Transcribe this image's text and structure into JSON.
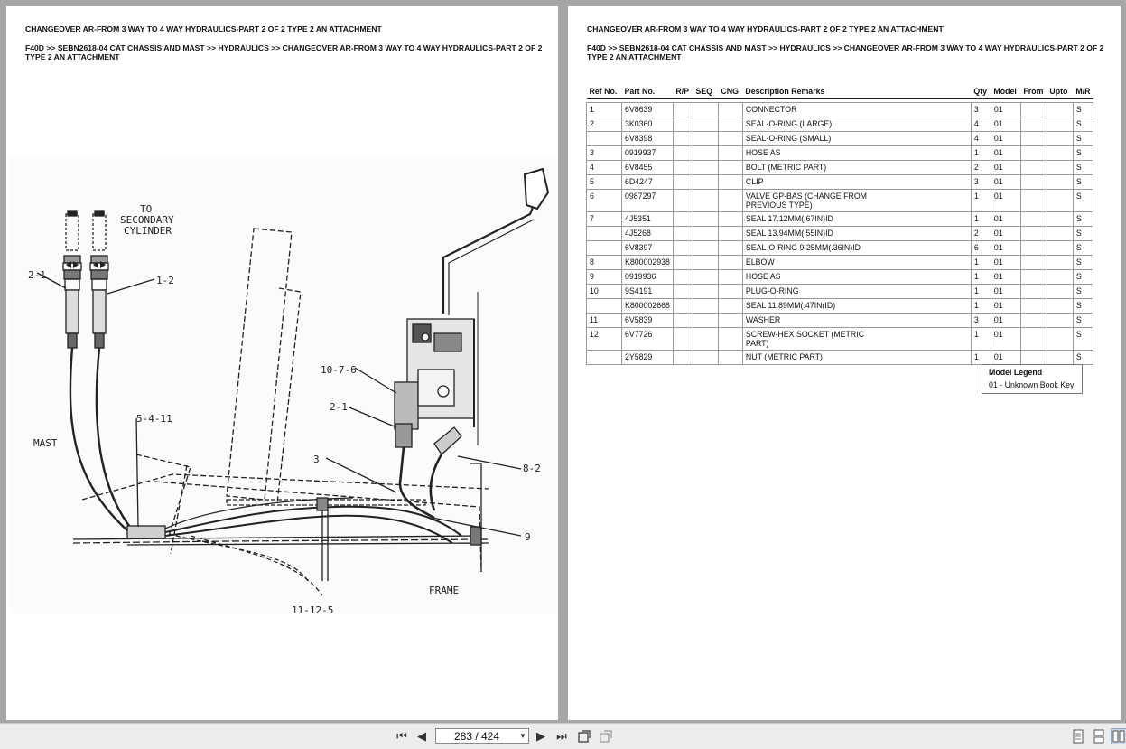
{
  "title": "CHANGEOVER AR-FROM 3 WAY TO 4 WAY HYDRAULICS-PART 2 OF 2 TYPE 2 AN ATTACHMENT",
  "breadcrumb": "F40D >> SEBN2618-04 CAT CHASSIS AND MAST >> HYDRAULICS >> CHANGEOVER AR-FROM 3 WAY TO 4 WAY HYDRAULICS-PART 2 OF 2 TYPE 2 AN ATTACHMENT",
  "figure": {
    "labels": {
      "to_secondary_1": "TO",
      "to_secondary_2": "SECONDARY",
      "to_secondary_3": "CYLINDER",
      "l_2_1_top": "2-1",
      "l_1_2": "1-2",
      "l_10_7_6": "10-7-6",
      "l_2_1_mid": "2-1",
      "l_5_4_11": "5-4-11",
      "l_mast": "MAST",
      "l_3": "3",
      "l_8_2": "8-2",
      "l_9": "9",
      "l_frame": "FRAME",
      "l_11_12_5": "11-12-5"
    }
  },
  "table": {
    "headers": {
      "ref": "Ref No.",
      "part": "Part No.",
      "rp": "R/P",
      "seq": "SEQ",
      "cng": "CNG",
      "desc": "Description Remarks",
      "qty": "Qty",
      "model": "Model",
      "from": "From",
      "upto": "Upto",
      "mr": "M/R"
    },
    "rows": [
      {
        "ref": "1",
        "part": "6V8639",
        "desc": "CONNECTOR",
        "qty": "3",
        "model": "01",
        "mr": "S"
      },
      {
        "ref": "2",
        "part": "3K0360",
        "desc": "SEAL-O-RING (LARGE)",
        "qty": "4",
        "model": "01",
        "mr": "S"
      },
      {
        "ref": "",
        "part": "6V8398",
        "desc": "SEAL-O-RING (SMALL)",
        "qty": "4",
        "model": "01",
        "mr": "S"
      },
      {
        "ref": "3",
        "part": "0919937",
        "desc": "HOSE AS",
        "qty": "1",
        "model": "01",
        "mr": "S"
      },
      {
        "ref": "4",
        "part": "6V8455",
        "desc": "BOLT (METRIC PART)",
        "qty": "2",
        "model": "01",
        "mr": "S"
      },
      {
        "ref": "5",
        "part": "6D4247",
        "desc": "CLIP",
        "qty": "3",
        "model": "01",
        "mr": "S"
      },
      {
        "ref": "6",
        "part": "0987297",
        "desc": "VALVE GP-BAS (CHANGE FROM",
        "desc2": "PREVIOUS TYPE)",
        "qty": "1",
        "model": "01",
        "mr": "S"
      },
      {
        "ref": "7",
        "part": "4J5351",
        "desc": "SEAL 17.12MM(.67IN)ID",
        "qty": "1",
        "model": "01",
        "mr": "S"
      },
      {
        "ref": "",
        "part": "4J5268",
        "desc": "SEAL 13.94MM(.55IN)ID",
        "qty": "2",
        "model": "01",
        "mr": "S"
      },
      {
        "ref": "",
        "part": "6V8397",
        "desc": "SEAL-O-RING 9.25MM(.36IN)ID",
        "qty": "6",
        "model": "01",
        "mr": "S"
      },
      {
        "ref": "8",
        "part": "K800002938",
        "desc": "ELBOW",
        "qty": "1",
        "model": "01",
        "mr": "S"
      },
      {
        "ref": "9",
        "part": "0919936",
        "desc": "HOSE AS",
        "qty": "1",
        "model": "01",
        "mr": "S"
      },
      {
        "ref": "10",
        "part": "9S4191",
        "desc": "PLUG-O-RING",
        "qty": "1",
        "model": "01",
        "mr": "S"
      },
      {
        "ref": "",
        "part": "K800002668",
        "desc": "SEAL 11.89MM(.47IN(ID)",
        "qty": "1",
        "model": "01",
        "mr": "S"
      },
      {
        "ref": "11",
        "part": "6V5839",
        "desc": "WASHER",
        "qty": "3",
        "model": "01",
        "mr": "S"
      },
      {
        "ref": "12",
        "part": "6V7726",
        "desc": "SCREW-HEX SOCKET (METRIC",
        "desc2": "PART)",
        "qty": "1",
        "model": "01",
        "mr": "S"
      },
      {
        "ref": "",
        "part": "2Y5829",
        "desc": "NUT (METRIC PART)",
        "qty": "1",
        "model": "01",
        "mr": "S"
      }
    ]
  },
  "legend": {
    "title": "Model Legend",
    "entry": "01 - Unknown Book Key"
  },
  "toolbar": {
    "page_indicator": "283 / 424",
    "first_icon": "⏮",
    "prev_icon": "◀",
    "next_icon": "▶",
    "last_icon": "⏭"
  }
}
